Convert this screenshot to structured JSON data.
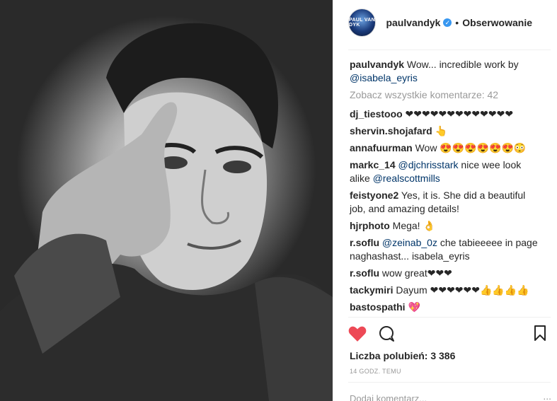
{
  "post": {
    "avatar_text": "PAUL VAN DYK",
    "username": "paulvandyk",
    "dot": "•",
    "follow_label": "Obserwowanie",
    "caption_user": "paulvandyk",
    "caption_text": " Wow... incredible work by ",
    "caption_mention": "@isabela_eyris",
    "view_all": "Zobacz wszystkie komentarze: 42",
    "likes": "Liczba polubień: 3 386",
    "time": "14 GODZ. TEMU",
    "add_comment_placeholder": "Dodaj komentarz...",
    "more_icon": "..."
  },
  "comments": [
    {
      "user": "dj_tiestooo",
      "text": " ❤❤❤❤❤❤❤❤❤❤❤❤❤"
    },
    {
      "user": "shervin.shojafard",
      "text": " 👆"
    },
    {
      "user": "annafuurman",
      "text": " Wow 😍😍😍😍😍😍😳"
    },
    {
      "user": "markc_14",
      "mention": " @djchrisstark",
      "text": " nice wee look alike ",
      "mention2": "@realscottmills"
    },
    {
      "user": "feistyone2",
      "text": " Yes, it is. She did a beautiful job, and amazing details!"
    },
    {
      "user": "hjrphoto",
      "text": " Mega! 👌"
    },
    {
      "user": "r.soflu",
      "mention": " @zeinab_0z",
      "text": " che tabieeeee in page naghashast... isabela_eyris"
    },
    {
      "user": "r.soflu",
      "text": " wow great❤❤❤"
    },
    {
      "user": "tackymiri",
      "text": " Dayum ❤❤❤❤❤❤👍👍👍👍"
    },
    {
      "user": "bastospathi",
      "text": " 💖"
    }
  ],
  "icons": [
    "heart-icon",
    "comment-icon",
    "bookmark-icon",
    "verified-icon"
  ]
}
